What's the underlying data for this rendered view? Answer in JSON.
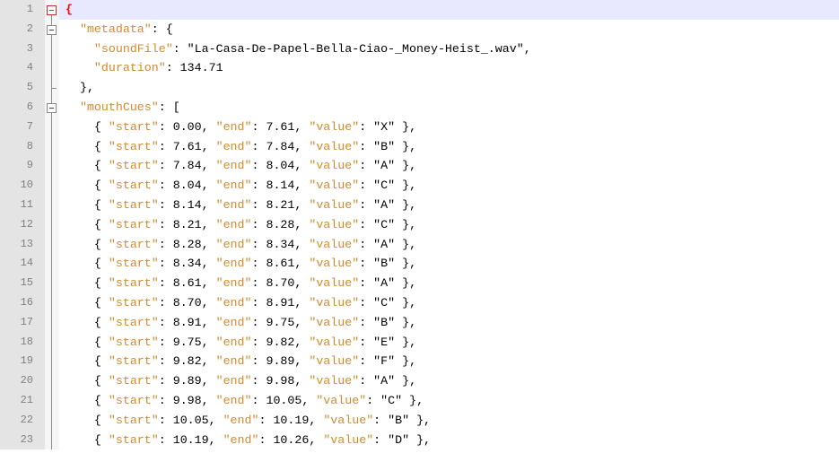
{
  "editor": {
    "language": "json",
    "current_line": 1,
    "lines": [
      {
        "num": "1",
        "fold": "open-top",
        "text": "{"
      },
      {
        "num": "2",
        "fold": "open",
        "text": "  \"metadata\": {"
      },
      {
        "num": "3",
        "fold": "bar",
        "text": "    \"soundFile\": \"La-Casa-De-Papel-Bella-Ciao-_Money-Heist_.wav\","
      },
      {
        "num": "4",
        "fold": "bar",
        "text": "    \"duration\": 134.71"
      },
      {
        "num": "5",
        "fold": "end",
        "text": "  },"
      },
      {
        "num": "6",
        "fold": "open",
        "text": "  \"mouthCues\": ["
      },
      {
        "num": "7",
        "fold": "bar",
        "text": "    { \"start\": 0.00, \"end\": 7.61, \"value\": \"X\" },"
      },
      {
        "num": "8",
        "fold": "bar",
        "text": "    { \"start\": 7.61, \"end\": 7.84, \"value\": \"B\" },"
      },
      {
        "num": "9",
        "fold": "bar",
        "text": "    { \"start\": 7.84, \"end\": 8.04, \"value\": \"A\" },"
      },
      {
        "num": "10",
        "fold": "bar",
        "text": "    { \"start\": 8.04, \"end\": 8.14, \"value\": \"C\" },"
      },
      {
        "num": "11",
        "fold": "bar",
        "text": "    { \"start\": 8.14, \"end\": 8.21, \"value\": \"A\" },"
      },
      {
        "num": "12",
        "fold": "bar",
        "text": "    { \"start\": 8.21, \"end\": 8.28, \"value\": \"C\" },"
      },
      {
        "num": "13",
        "fold": "bar",
        "text": "    { \"start\": 8.28, \"end\": 8.34, \"value\": \"A\" },"
      },
      {
        "num": "14",
        "fold": "bar",
        "text": "    { \"start\": 8.34, \"end\": 8.61, \"value\": \"B\" },"
      },
      {
        "num": "15",
        "fold": "bar",
        "text": "    { \"start\": 8.61, \"end\": 8.70, \"value\": \"A\" },"
      },
      {
        "num": "16",
        "fold": "bar",
        "text": "    { \"start\": 8.70, \"end\": 8.91, \"value\": \"C\" },"
      },
      {
        "num": "17",
        "fold": "bar",
        "text": "    { \"start\": 8.91, \"end\": 9.75, \"value\": \"B\" },"
      },
      {
        "num": "18",
        "fold": "bar",
        "text": "    { \"start\": 9.75, \"end\": 9.82, \"value\": \"E\" },"
      },
      {
        "num": "19",
        "fold": "bar",
        "text": "    { \"start\": 9.82, \"end\": 9.89, \"value\": \"F\" },"
      },
      {
        "num": "20",
        "fold": "bar",
        "text": "    { \"start\": 9.89, \"end\": 9.98, \"value\": \"A\" },"
      },
      {
        "num": "21",
        "fold": "bar",
        "text": "    { \"start\": 9.98, \"end\": 10.05, \"value\": \"C\" },"
      },
      {
        "num": "22",
        "fold": "bar",
        "text": "    { \"start\": 10.05, \"end\": 10.19, \"value\": \"B\" },"
      },
      {
        "num": "23",
        "fold": "bar",
        "text": "    { \"start\": 10.19, \"end\": 10.26, \"value\": \"D\" },"
      }
    ]
  },
  "colors": {
    "key": "#d08a2e",
    "gutter_bg": "#e4e4e4",
    "gutter_text": "#808080",
    "current_line_bg": "#e8e8ff",
    "brace_match": "#ff0000"
  }
}
